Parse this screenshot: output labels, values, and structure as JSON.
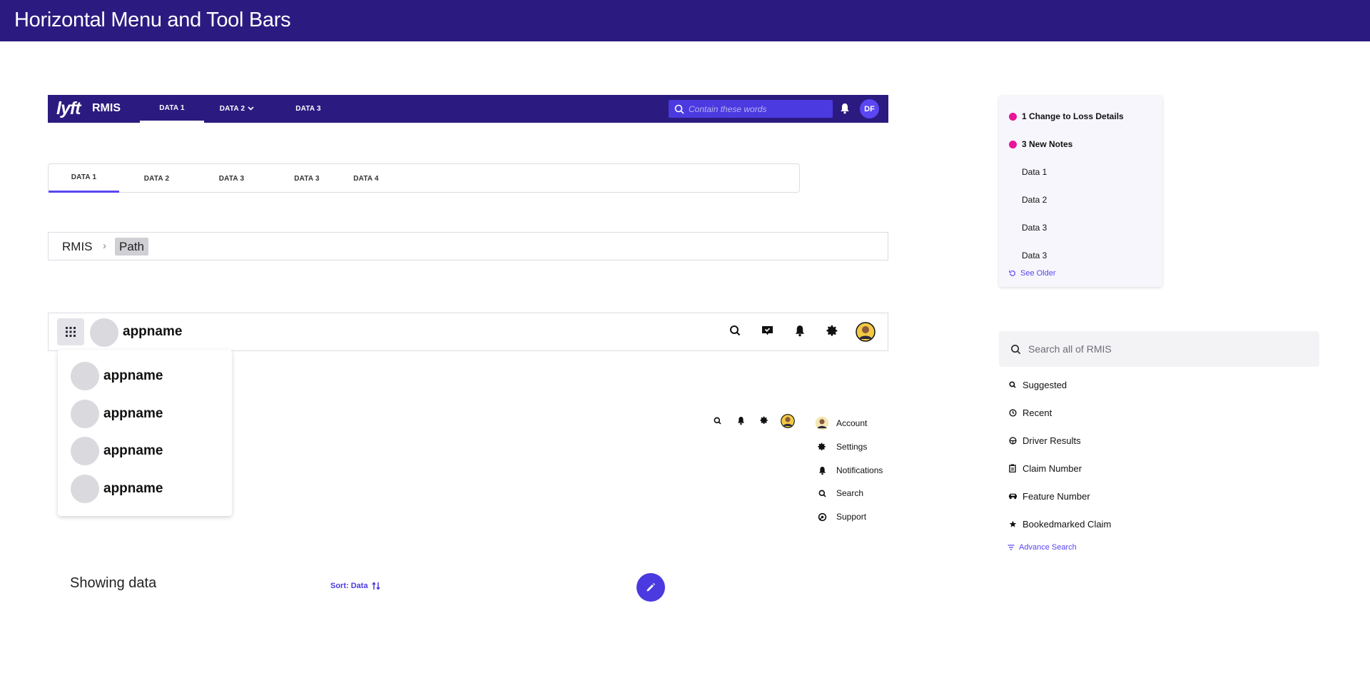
{
  "page": {
    "title": "Horizontal Menu and Tool Bars"
  },
  "appbar": {
    "logo": "lyft",
    "brand": "RMIS",
    "nav": [
      {
        "label": "DATA 1"
      },
      {
        "label": "DATA 2"
      },
      {
        "label": "DATA 3"
      }
    ],
    "search_placeholder": "Contain these words",
    "avatar_initials": "DF"
  },
  "tabs": [
    {
      "label": "DATA 1"
    },
    {
      "label": "DATA 2"
    },
    {
      "label": "DATA 3"
    },
    {
      "label": "DATA 3"
    },
    {
      "label": "DATA 4"
    }
  ],
  "breadcrumb": {
    "root": "RMIS",
    "separator": "›",
    "current": "Path"
  },
  "launcher": {
    "appname": "appname",
    "dropdown_apps": [
      "appname",
      "appname",
      "appname",
      "appname"
    ]
  },
  "user_menu": [
    {
      "label": "Account",
      "icon": "avatar-icon"
    },
    {
      "label": "Settings",
      "icon": "gear-icon"
    },
    {
      "label": "Notifications",
      "icon": "bell-icon"
    },
    {
      "label": "Search",
      "icon": "search-icon"
    },
    {
      "label": "Support",
      "icon": "support-icon"
    }
  ],
  "list_toolbar": {
    "showing": "Showing data",
    "sort": "Sort: Data"
  },
  "notifications": {
    "items": [
      {
        "label": "1 Change to Loss Details",
        "unread": true
      },
      {
        "label": "3 New Notes",
        "unread": true
      },
      {
        "label": "Data 1",
        "unread": false
      },
      {
        "label": "Data 2",
        "unread": false
      },
      {
        "label": "Data 3",
        "unread": false
      },
      {
        "label": "Data 3",
        "unread": false
      }
    ],
    "see_older": "See Older"
  },
  "search_panel": {
    "placeholder": "Search all of RMIS",
    "items": [
      {
        "label": "Suggested",
        "icon": "search-icon"
      },
      {
        "label": "Recent",
        "icon": "clock-icon"
      },
      {
        "label": "Driver Results",
        "icon": "steering-wheel-icon"
      },
      {
        "label": "Claim Number",
        "icon": "clipboard-icon"
      },
      {
        "label": "Feature Number",
        "icon": "car-icon"
      },
      {
        "label": "Bookedmarked Claim",
        "icon": "star-icon"
      }
    ],
    "advance": "Advance Search"
  },
  "colors": {
    "brand": "#2b1b80",
    "accent": "#5a46f2",
    "unread_dot": "#e8149a"
  }
}
